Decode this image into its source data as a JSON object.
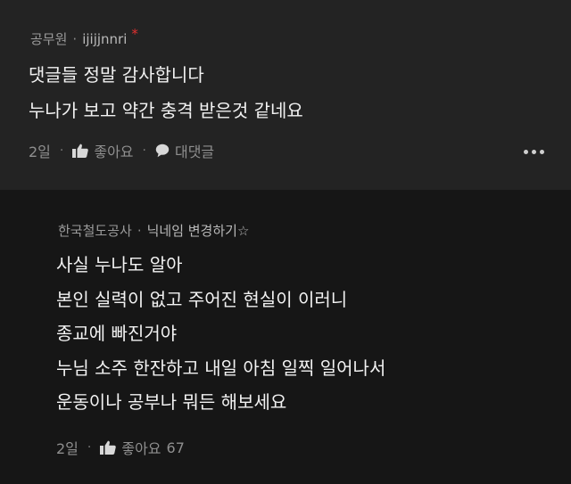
{
  "comment": {
    "author": "공무원",
    "nickname": "ijijjnnri",
    "badge": "*",
    "lines": [
      "댓글들 정말 감사합니다",
      "누나가 보고 약간 충격 받은것 같네요"
    ],
    "time": "2일",
    "like_label": "좋아요",
    "reply_label": "대댓글"
  },
  "reply": {
    "author": "한국철도공사",
    "nickname": "닉네임 변경하기☆",
    "lines": [
      "사실 누나도 알아",
      "본인 실력이 없고 주어진 현실이 이러니",
      "종교에 빠진거야",
      "누님 소주 한잔하고 내일 아침 일찍 일어나서",
      "운동이나 공부나 뭐든 해보세요"
    ],
    "time": "2일",
    "like_label": "좋아요",
    "like_count": "67"
  },
  "separator": "·",
  "colors": {
    "bg_top": "#232323",
    "bg_reply": "#161616",
    "badge": "#e0302f"
  }
}
